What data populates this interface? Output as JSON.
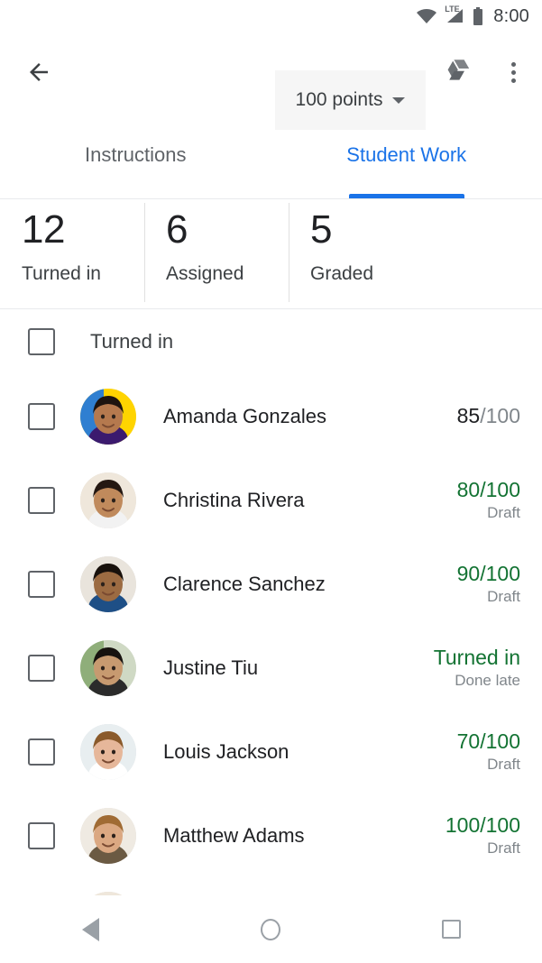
{
  "statusbar": {
    "wifi_icon": "wifi-icon",
    "network_label": "LTE",
    "signal_icon": "cellular-signal-icon",
    "battery_icon": "battery-icon",
    "time": "8:00"
  },
  "toolbar": {
    "back_icon": "back-arrow-icon",
    "points_label": "100 points",
    "points_caret_icon": "chevron-down-icon",
    "drive_icon": "google-drive-icon",
    "overflow_icon": "more-vertical-icon",
    "chip_background": "#f6f6f6"
  },
  "tabs": {
    "active_color": "#1a73e8",
    "inactive_color": "#5f6368",
    "items": [
      {
        "label": "Instructions",
        "active": false
      },
      {
        "label": "Student Work",
        "active": true
      }
    ]
  },
  "stats": [
    {
      "count": "12",
      "label": "Turned in"
    },
    {
      "count": "6",
      "label": "Assigned"
    },
    {
      "count": "5",
      "label": "Graded"
    }
  ],
  "list": {
    "section_header": {
      "label": "Turned in",
      "checkbox_checked": false
    },
    "colors": {
      "draft_green": "#137333",
      "graded_dark": "#202124",
      "muted_gray": "#80868b"
    },
    "students": [
      {
        "name": "Amanda Gonzales",
        "avatar_name": "avatar-amanda-gonzales",
        "state": "graded",
        "score_value": "85",
        "score_max": "/100",
        "score_sub": ""
      },
      {
        "name": "Christina Rivera",
        "avatar_name": "avatar-christina-rivera",
        "state": "draft",
        "score_value": "80",
        "score_max": "/100",
        "score_sub": "Draft"
      },
      {
        "name": "Clarence Sanchez",
        "avatar_name": "avatar-clarence-sanchez",
        "state": "draft",
        "score_value": "90",
        "score_max": "/100",
        "score_sub": "Draft"
      },
      {
        "name": "Justine Tiu",
        "avatar_name": "avatar-justine-tiu",
        "state": "turned-in",
        "score_value": "Turned in",
        "score_max": "",
        "score_sub": "Done late"
      },
      {
        "name": "Louis Jackson",
        "avatar_name": "avatar-louis-jackson",
        "state": "draft",
        "score_value": "70",
        "score_max": "/100",
        "score_sub": "Draft"
      },
      {
        "name": "Matthew Adams",
        "avatar_name": "avatar-matthew-adams",
        "state": "draft",
        "score_value": "100",
        "score_max": "/100",
        "score_sub": "Draft"
      }
    ]
  },
  "navbar": {
    "back_icon": "nav-back-icon",
    "home_icon": "nav-home-icon",
    "recents_icon": "nav-recents-icon"
  }
}
